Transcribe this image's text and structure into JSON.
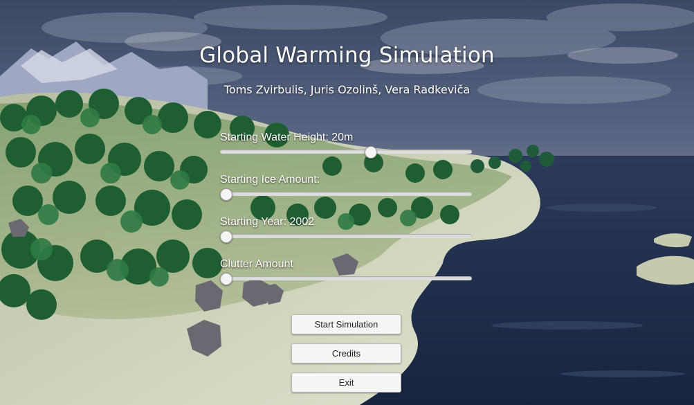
{
  "menu": {
    "title": "Global Warming Simulation",
    "authors": "Toms Zvirbulis, Juris Ozolinš, Vera Radkeviča"
  },
  "settings": [
    {
      "label": "Starting Water Height: 20m",
      "value": 0.6
    },
    {
      "label": "Starting Ice Amount:",
      "value": 0.0
    },
    {
      "label": "Starting Year: 2002",
      "value": 0.0
    },
    {
      "label": "Clutter Amount",
      "value": 0.0
    }
  ],
  "buttons": {
    "start": "Start Simulation",
    "credits": "Credits",
    "exit": "Exit"
  },
  "colors": {
    "sky_top": "#3b4763",
    "sky_horizon": "#c79a8c",
    "water": "#1c2f4f",
    "sand": "#c9cdb0",
    "forest": "#2a6a34",
    "slider_track": "#dcdcdc",
    "button_bg": "#f5f5f5"
  }
}
